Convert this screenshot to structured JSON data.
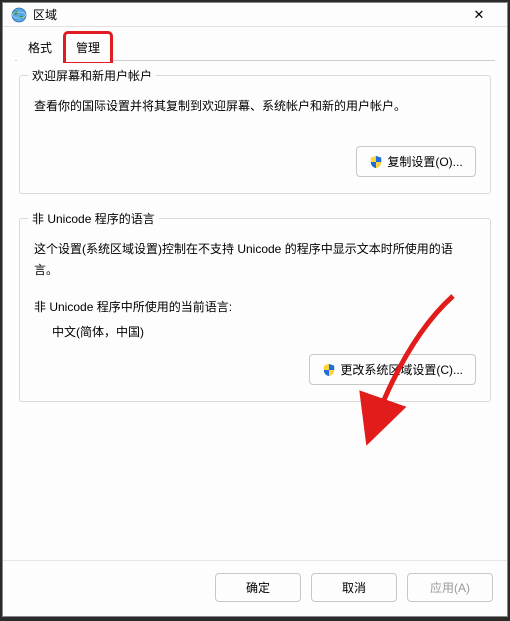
{
  "window": {
    "title": "区域"
  },
  "tabs": {
    "format": "格式",
    "admin": "管理"
  },
  "group1": {
    "legend": "欢迎屏幕和新用户帐户",
    "desc": "查看你的国际设置并将其复制到欢迎屏幕、系统帐户和新的用户帐户。",
    "copy_btn": "复制设置(O)..."
  },
  "group2": {
    "legend": "非 Unicode 程序的语言",
    "desc": "这个设置(系统区域设置)控制在不支持 Unicode 的程序中显示文本时所使用的语言。",
    "current_label": "非 Unicode 程序中所使用的当前语言:",
    "current_value": "中文(简体，中国)",
    "change_btn": "更改系统区域设置(C)..."
  },
  "footer": {
    "ok": "确定",
    "cancel": "取消",
    "apply": "应用(A)"
  }
}
